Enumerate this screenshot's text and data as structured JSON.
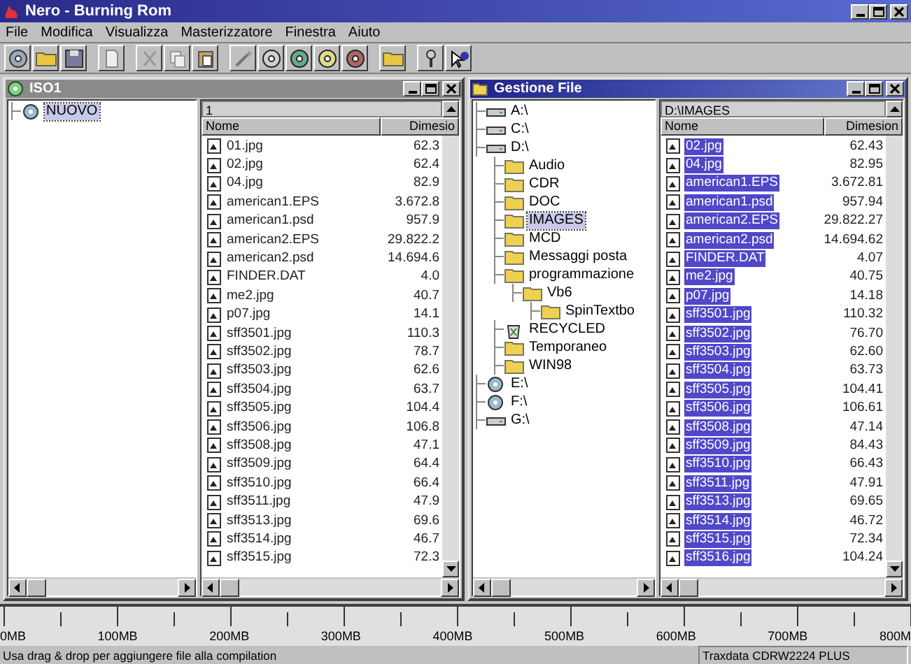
{
  "window": {
    "title": "Nero - Burning Rom"
  },
  "menu": [
    "File",
    "Modifica",
    "Visualizza",
    "Masterizzatore",
    "Finestra",
    "Aiuto"
  ],
  "panels": [
    {
      "title": "ISO1",
      "tree": [
        {
          "label": "NUOVO",
          "kind": "disc",
          "selected": true
        }
      ],
      "path": "1",
      "columns": [
        "Nome",
        "Dimesio"
      ],
      "rows": [
        {
          "name": "01.jpg",
          "size": "62.3",
          "selected": false
        },
        {
          "name": "02.jpg",
          "size": "62.4",
          "selected": false
        },
        {
          "name": "04.jpg",
          "size": "82.9",
          "selected": false
        },
        {
          "name": "american1.EPS",
          "size": "3.672.8",
          "selected": false
        },
        {
          "name": "american1.psd",
          "size": "957.9",
          "selected": false
        },
        {
          "name": "american2.EPS",
          "size": "29.822.2",
          "selected": false
        },
        {
          "name": "american2.psd",
          "size": "14.694.6",
          "selected": false
        },
        {
          "name": "FINDER.DAT",
          "size": "4.0",
          "selected": false
        },
        {
          "name": "me2.jpg",
          "size": "40.7",
          "selected": false
        },
        {
          "name": "p07.jpg",
          "size": "14.1",
          "selected": false
        },
        {
          "name": "sff3501.jpg",
          "size": "110.3",
          "selected": false
        },
        {
          "name": "sff3502.jpg",
          "size": "78.7",
          "selected": false
        },
        {
          "name": "sff3503.jpg",
          "size": "62.6",
          "selected": false
        },
        {
          "name": "sff3504.jpg",
          "size": "63.7",
          "selected": false
        },
        {
          "name": "sff3505.jpg",
          "size": "104.4",
          "selected": false
        },
        {
          "name": "sff3506.jpg",
          "size": "106.8",
          "selected": false
        },
        {
          "name": "sff3508.jpg",
          "size": "47.1",
          "selected": false
        },
        {
          "name": "sff3509.jpg",
          "size": "64.4",
          "selected": false
        },
        {
          "name": "sff3510.jpg",
          "size": "66.4",
          "selected": false
        },
        {
          "name": "sff3511.jpg",
          "size": "47.9",
          "selected": false
        },
        {
          "name": "sff3513.jpg",
          "size": "69.6",
          "selected": false
        },
        {
          "name": "sff3514.jpg",
          "size": "46.7",
          "selected": false
        },
        {
          "name": "sff3515.jpg",
          "size": "72.3",
          "selected": false
        }
      ]
    },
    {
      "title": "Gestione File",
      "tree": [
        {
          "label": "A:\\",
          "kind": "drive",
          "selected": false
        },
        {
          "label": "C:\\",
          "kind": "drive",
          "selected": false
        },
        {
          "label": "D:\\",
          "kind": "drive",
          "selected": false,
          "children": [
            {
              "label": "Audio",
              "kind": "folder",
              "selected": false
            },
            {
              "label": "CDR",
              "kind": "folder",
              "selected": false
            },
            {
              "label": "DOC",
              "kind": "folder",
              "selected": false
            },
            {
              "label": "IMAGES",
              "kind": "folder",
              "selected": true
            },
            {
              "label": "MCD",
              "kind": "folder",
              "selected": false
            },
            {
              "label": "Messaggi posta",
              "kind": "folder",
              "selected": false
            },
            {
              "label": "programmazione",
              "kind": "folder",
              "selected": false,
              "children": [
                {
                  "label": "Vb6",
                  "kind": "folder",
                  "selected": false,
                  "children": [
                    {
                      "label": "SpinTextbo",
                      "kind": "folder",
                      "selected": false
                    }
                  ]
                }
              ]
            },
            {
              "label": "RECYCLED",
              "kind": "recycle",
              "selected": false
            },
            {
              "label": "Temporaneo",
              "kind": "folder",
              "selected": false
            },
            {
              "label": "WIN98",
              "kind": "folder",
              "selected": false
            }
          ]
        },
        {
          "label": "E:\\",
          "kind": "disc",
          "selected": false
        },
        {
          "label": "F:\\",
          "kind": "disc",
          "selected": false
        },
        {
          "label": "G:\\",
          "kind": "drive",
          "selected": false
        }
      ],
      "path": "D:\\IMAGES",
      "columns": [
        "Nome",
        "Dimesion"
      ],
      "rows": [
        {
          "name": "02.jpg",
          "size": "62.43",
          "selected": true
        },
        {
          "name": "04.jpg",
          "size": "82.95",
          "selected": true
        },
        {
          "name": "american1.EPS",
          "size": "3.672.81",
          "selected": true
        },
        {
          "name": "american1.psd",
          "size": "957.94",
          "selected": true
        },
        {
          "name": "american2.EPS",
          "size": "29.822.27",
          "selected": true
        },
        {
          "name": "american2.psd",
          "size": "14.694.62",
          "selected": true
        },
        {
          "name": "FINDER.DAT",
          "size": "4.07",
          "selected": true
        },
        {
          "name": "me2.jpg",
          "size": "40.75",
          "selected": true
        },
        {
          "name": "p07.jpg",
          "size": "14.18",
          "selected": true
        },
        {
          "name": "sff3501.jpg",
          "size": "110.32",
          "selected": true
        },
        {
          "name": "sff3502.jpg",
          "size": "76.70",
          "selected": true
        },
        {
          "name": "sff3503.jpg",
          "size": "62.60",
          "selected": true
        },
        {
          "name": "sff3504.jpg",
          "size": "63.73",
          "selected": true
        },
        {
          "name": "sff3505.jpg",
          "size": "104.41",
          "selected": true
        },
        {
          "name": "sff3506.jpg",
          "size": "106.61",
          "selected": true
        },
        {
          "name": "sff3508.jpg",
          "size": "47.14",
          "selected": true
        },
        {
          "name": "sff3509.jpg",
          "size": "84.43",
          "selected": true
        },
        {
          "name": "sff3510.jpg",
          "size": "66.43",
          "selected": true
        },
        {
          "name": "sff3511.jpg",
          "size": "47.91",
          "selected": true
        },
        {
          "name": "sff3513.jpg",
          "size": "69.65",
          "selected": true
        },
        {
          "name": "sff3514.jpg",
          "size": "46.72",
          "selected": true
        },
        {
          "name": "sff3515.jpg",
          "size": "72.34",
          "selected": true
        },
        {
          "name": "sff3516.jpg",
          "size": "104.24",
          "selected": true
        }
      ]
    }
  ],
  "ruler": [
    "0MB",
    "100MB",
    "200MB",
    "300MB",
    "400MB",
    "500MB",
    "600MB",
    "700MB",
    "800M"
  ],
  "status_bar": {
    "hint": "Usa drag & drop per aggiungere file alla compilation",
    "recorder": "Traxdata CDRW2224 PLUS"
  }
}
